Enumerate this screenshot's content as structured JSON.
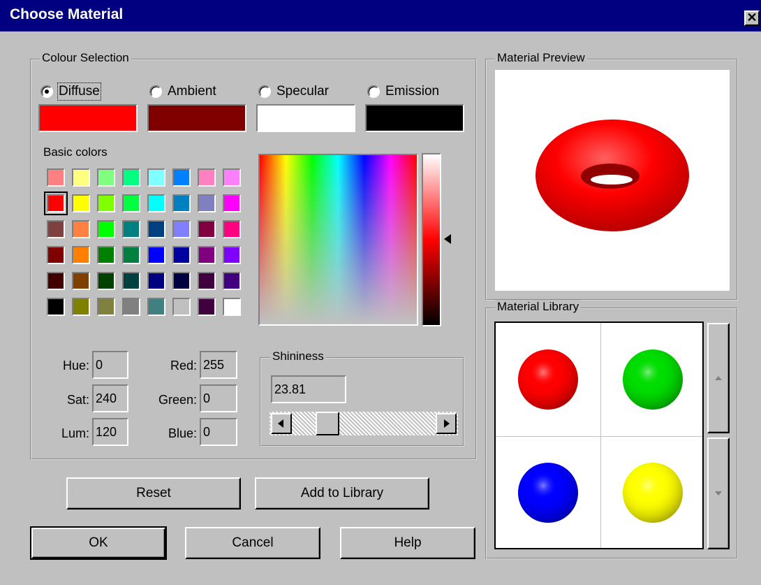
{
  "window": {
    "title": "Choose Material",
    "close_glyph": "✕"
  },
  "colour_selection": {
    "label": "Colour Selection",
    "modes": [
      {
        "label": "Diffuse",
        "checked": true,
        "color": "#ff0000"
      },
      {
        "label": "Ambient",
        "checked": false,
        "color": "#800000"
      },
      {
        "label": "Specular",
        "checked": false,
        "color": "#ffffff"
      },
      {
        "label": "Emission",
        "checked": false,
        "color": "#000000"
      }
    ],
    "basic_colors_label": "Basic colors",
    "basic_colors": [
      [
        "#ff8080",
        "#ffff80",
        "#80ff80",
        "#00ff80",
        "#80ffff",
        "#0080ff",
        "#ff80c0",
        "#ff80ff"
      ],
      [
        "#ff0000",
        "#ffff00",
        "#80ff00",
        "#00ff40",
        "#00ffff",
        "#0080c0",
        "#8080c0",
        "#ff00ff"
      ],
      [
        "#804040",
        "#ff8040",
        "#00ff00",
        "#008080",
        "#004080",
        "#8080ff",
        "#800040",
        "#ff0080"
      ],
      [
        "#800000",
        "#ff8000",
        "#008000",
        "#008040",
        "#0000ff",
        "#0000a0",
        "#800080",
        "#8000ff"
      ],
      [
        "#400000",
        "#804000",
        "#004000",
        "#004040",
        "#000080",
        "#000040",
        "#400040",
        "#400080"
      ],
      [
        "#000000",
        "#808000",
        "#808040",
        "#808080",
        "#408080",
        "#c0c0c0",
        "#400040",
        "#ffffff"
      ]
    ],
    "hue_label": "Hue:",
    "hue": "0",
    "sat_label": "Sat:",
    "sat": "240",
    "lum_label": "Lum:",
    "lum": "120",
    "red_label": "Red:",
    "red": "255",
    "green_label": "Green:",
    "green": "0",
    "blue_label": "Blue:",
    "blue": "0"
  },
  "shininess": {
    "label": "Shininess",
    "value": "23.81",
    "slider_fraction": 0.19
  },
  "buttons": {
    "reset": "Reset",
    "add_to_library": "Add to Library",
    "ok": "OK",
    "cancel": "Cancel",
    "help": "Help"
  },
  "material_preview": {
    "label": "Material Preview",
    "color": "#ff0000"
  },
  "material_library": {
    "label": "Material Library",
    "materials": [
      "#ff0000",
      "#00dd00",
      "#0000ff",
      "#ffff00"
    ]
  }
}
